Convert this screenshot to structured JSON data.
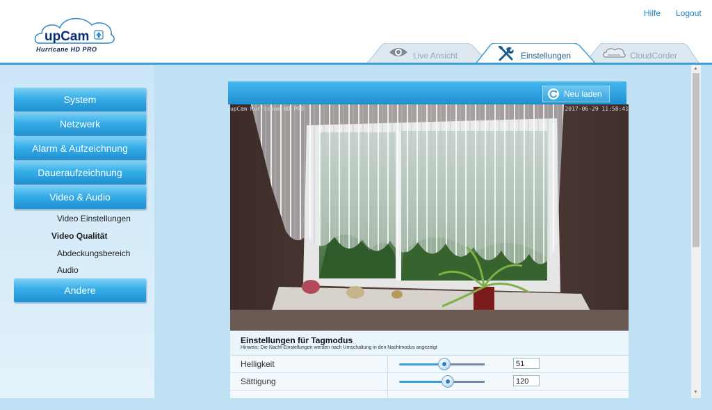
{
  "header": {
    "brand": "upCam",
    "brand_sub": "Hurricane HD PRO",
    "links": {
      "help": "Hilfe",
      "logout": "Logout"
    }
  },
  "tabs": [
    {
      "label": "Live Ansicht",
      "icon": "eye-icon",
      "active": false
    },
    {
      "label": "Einstellungen",
      "icon": "tools-icon",
      "active": true
    },
    {
      "label": "CloudCorder",
      "icon": "cloud-icon",
      "active": false
    }
  ],
  "sidebar": {
    "items": [
      {
        "label": "System"
      },
      {
        "label": "Netzwerk"
      },
      {
        "label": "Alarm & Aufzeichnung"
      },
      {
        "label": "Daueraufzeichnung"
      },
      {
        "label": "Video & Audio"
      },
      {
        "label": "Andere"
      }
    ],
    "subitems": [
      {
        "label": "Video Einstellungen",
        "active": false
      },
      {
        "label": "Video Qualität",
        "active": true
      },
      {
        "label": "Abdeckungsbereich",
        "active": false
      },
      {
        "label": "Audio",
        "active": false
      }
    ]
  },
  "toolbar": {
    "reload_label": "Neu laden"
  },
  "video": {
    "osd_left": "upCam Hurricane HD PRO",
    "osd_right": "2017-06-29 11:58:41"
  },
  "settings": {
    "title": "Einstellungen für Tagmodus",
    "hint": "Hinweis: Die Nacht-Einstellungen werden nach Umschaltung in den Nachtmodus angezeigt",
    "rows": [
      {
        "label": "Helligkeit",
        "value": "51",
        "level": 0.53
      },
      {
        "label": "Sättigung",
        "value": "120",
        "level": 0.57
      }
    ]
  },
  "colors": {
    "accent": "#3d9fd6",
    "nav": "#36aee8",
    "background": "#c0e0f4"
  }
}
